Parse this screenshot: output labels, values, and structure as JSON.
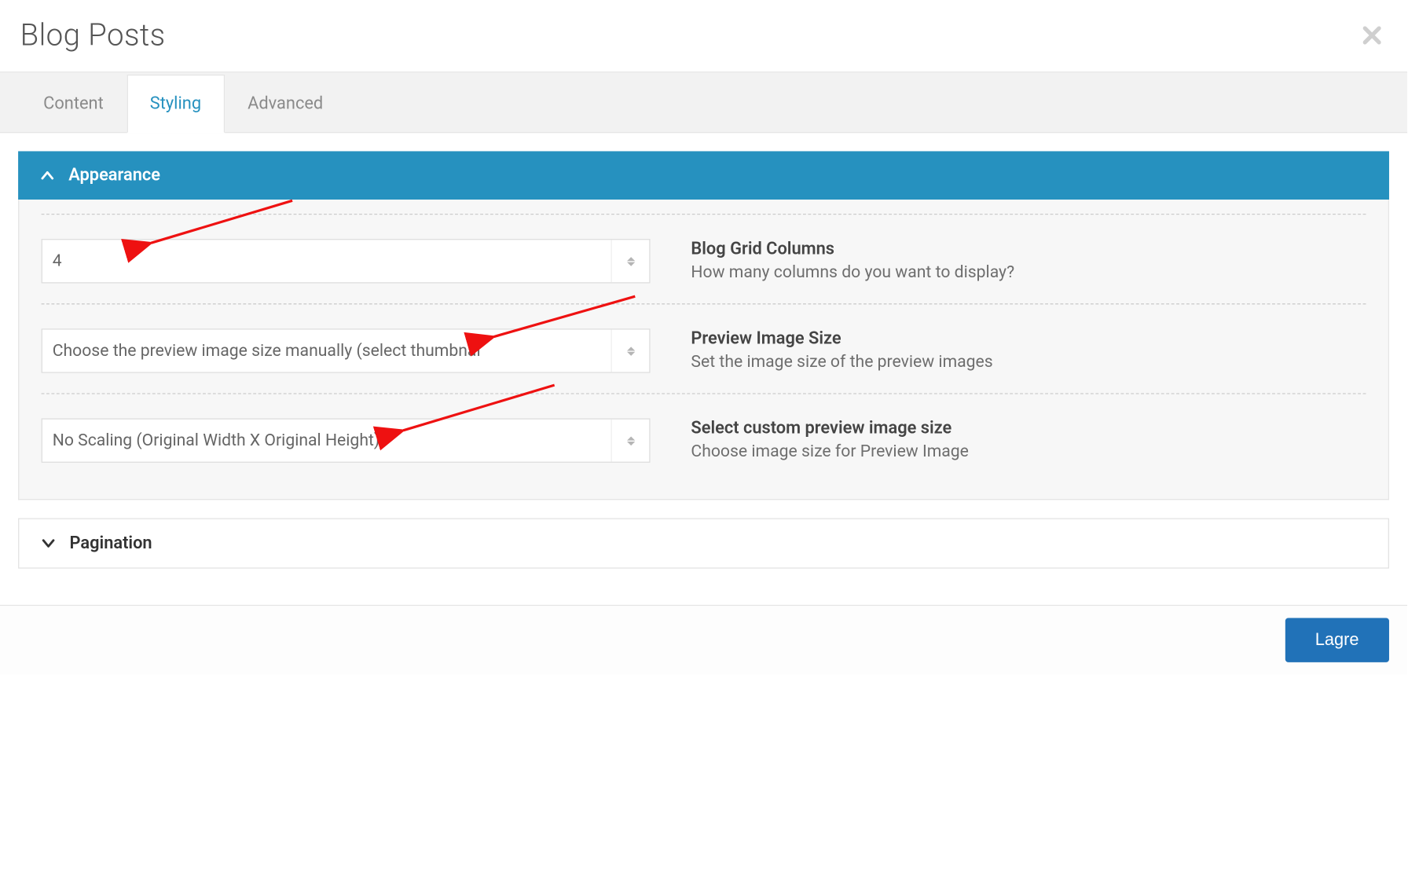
{
  "header": {
    "title": "Blog Posts"
  },
  "tabs": [
    {
      "id": "content",
      "label": "Content",
      "active": false
    },
    {
      "id": "styling",
      "label": "Styling",
      "active": true
    },
    {
      "id": "advanced",
      "label": "Advanced",
      "active": false
    }
  ],
  "sections": {
    "appearance": {
      "title": "Appearance",
      "expanded": true,
      "fields": [
        {
          "id": "columns",
          "value": "4",
          "label": "Blog Grid Columns",
          "description": "How many columns do you want to display?"
        },
        {
          "id": "preview_size",
          "value": "Choose the preview image size manually (select thumbnai",
          "label": "Preview Image Size",
          "description": "Set the image size of the preview images"
        },
        {
          "id": "custom_size",
          "value": "No Scaling (Original Width X Original Height)",
          "label": "Select custom preview image size",
          "description": "Choose image size for Preview Image"
        }
      ]
    },
    "pagination": {
      "title": "Pagination",
      "expanded": false
    }
  },
  "footer": {
    "save_label": "Lagre"
  }
}
